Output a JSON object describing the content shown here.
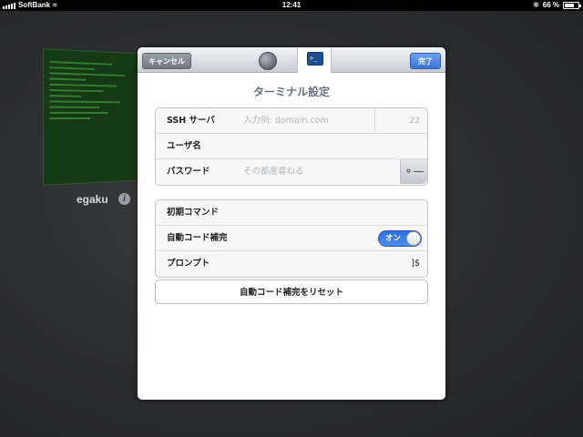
{
  "statusbar": {
    "carrier": "SoftBank",
    "time": "12:41",
    "battery_percent": "66 %",
    "battery_level": 0.66
  },
  "background": {
    "terminal_name": "egaku"
  },
  "modal": {
    "navbar": {
      "cancel_label": "キャンセル",
      "done_label": "完了",
      "tabs": [
        {
          "icon": "globe-icon"
        },
        {
          "icon": "terminal-icon",
          "selected": true
        }
      ]
    },
    "title": "ターミナル設定",
    "connection": {
      "ssh_server_label": "SSH サーバ",
      "ssh_server_placeholder": "入力例: domain.com",
      "port_placeholder": "22",
      "username_label": "ユーザ名",
      "password_label": "パスワード",
      "password_placeholder": "その都度尋ねる",
      "key_icon": "key-icon"
    },
    "options": {
      "initial_command_label": "初期コマンド",
      "autocomplete_label": "自動コード補完",
      "autocomplete_toggle_text": "オン",
      "prompt_label": "プロンプト",
      "prompt_value": "]$"
    },
    "reset_button_label": "自動コード補完をリセット"
  }
}
